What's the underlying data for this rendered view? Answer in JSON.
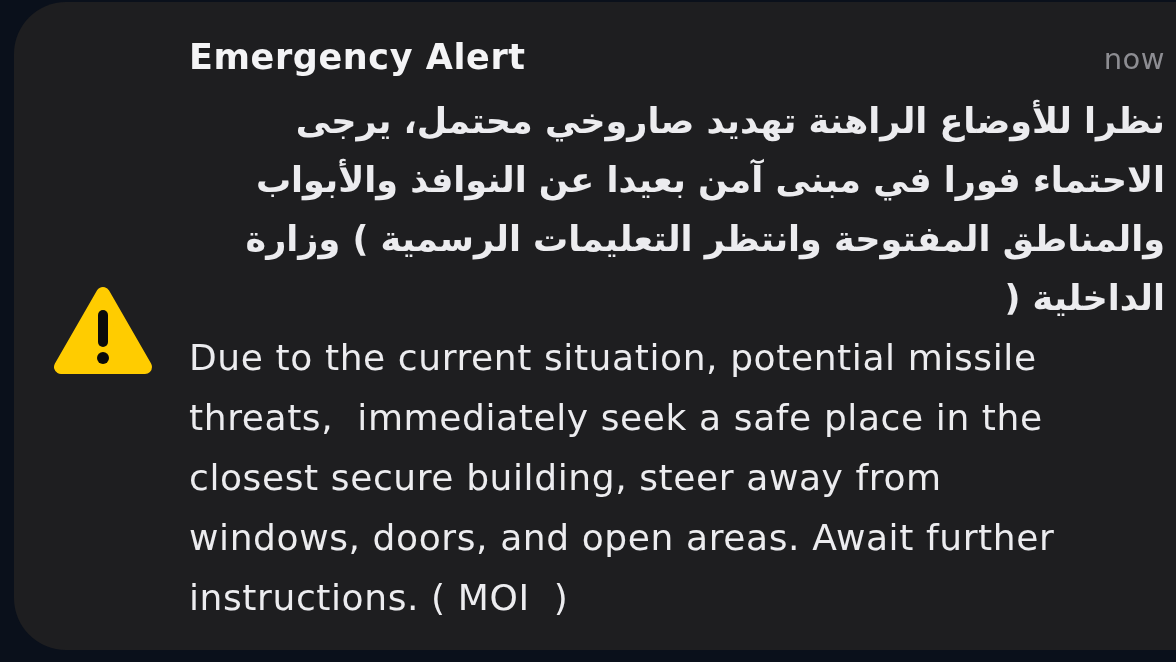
{
  "alert": {
    "title": "Emergency Alert",
    "time": "now",
    "messages": [
      {
        "kind": "arabic",
        "text": "نظرا للأوضاع الراهنة تهديد صاروخي محتمل، يرجى الاحتماء فورا في مبنى آمن بعيدا عن النوافذ والأبواب والمناطق المفتوحة وانتظر التعليمات الرسمية ) وزارة الداخلية ("
      },
      {
        "kind": "english",
        "text": "Due to the current situation, potential missile threats,  immediately seek a safe place in the closest secure building, steer away from windows, doors, and open areas. Await further instructions. ( MOI  )"
      }
    ]
  }
}
